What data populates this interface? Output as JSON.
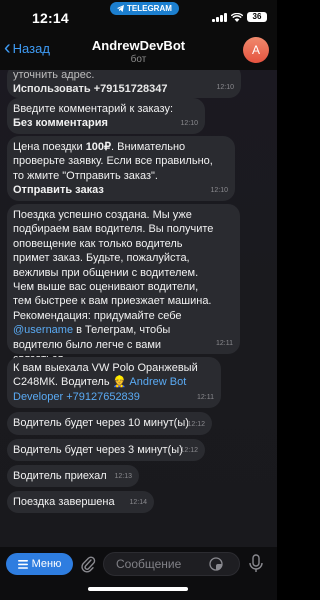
{
  "status_bar": {
    "time": "12:14",
    "app_badge": "TELEGRAM",
    "battery": "36"
  },
  "header": {
    "back_label": "Назад",
    "title": "AndrewDevBot",
    "subtitle": "бот",
    "avatar_letter": "A"
  },
  "messages": [
    {
      "line1": "уточнить адрес.",
      "link_text": "Использовать +79151728347",
      "time": "12:10"
    },
    {
      "line1": "Введите комментарий к заказу:",
      "line2": "Без комментария",
      "time": "12:10"
    },
    {
      "price_prefix": "Цена поездки ",
      "price": "100₽",
      "rest1": ". Внимательно",
      "line2": "проверьте заявку. Если все правильно,",
      "line3": "то жмите \"Отправить заказ\".",
      "line4": "Отправить заказ",
      "time": "12:10"
    },
    {
      "lines": [
        "Поездка успешно создана. Мы уже",
        "подбираем вам водителя. Вы получите",
        "оповещение как только водитель",
        "примет заказ. Будьте, пожалуйста,",
        "вежливы при общении с водителем.",
        "Чем выше вас оценивают водители,",
        "тем быстрее к вам приезжает машина.",
        "Рекомендация: придумайте себе"
      ],
      "username": "@username",
      "after_username": " в Телеграм, чтобы",
      "line10": "водителю было легче с вами",
      "line11": "связаться.",
      "time": "12:11"
    },
    {
      "line1": "К вам выехала VW Polo Оранжевый",
      "line2_prefix": "С248МК. Водитель ",
      "driver_emoji": "👷",
      "driver_name": " Andrew Bot",
      "driver_line3": "Developer +79127652839",
      "time": "12:11"
    },
    {
      "text": "Водитель будет через 10 минут(ы)",
      "time": "12:12"
    },
    {
      "text": "Водитель будет через 3 минут(ы)",
      "time": "12:12"
    },
    {
      "text": "Водитель приехал",
      "time": "12:13"
    },
    {
      "text": "Поездка завершена",
      "time": "12:14"
    }
  ],
  "composer": {
    "menu_label": "Меню",
    "placeholder": "Сообщение"
  },
  "colors": {
    "accent": "#3f9cf5",
    "menu_button": "#2e7de0",
    "bubble": "#2a2b30"
  }
}
